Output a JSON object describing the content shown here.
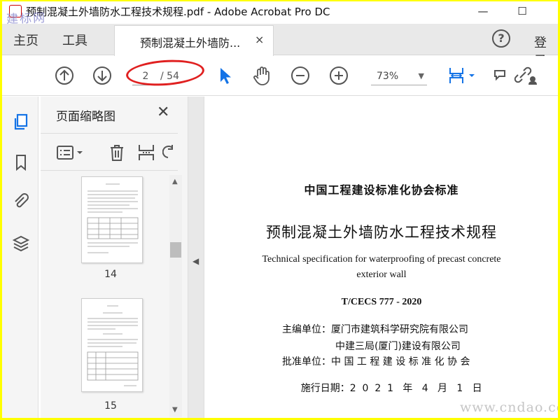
{
  "window": {
    "title": "预制混凝土外墙防水工程技术规程.pdf - Adobe Acrobat Pro DC",
    "minimize": "—",
    "maximize": "☐"
  },
  "watermark_top": "建标网",
  "tabs": {
    "home": "主页",
    "tools": "工具",
    "doc": "预制混凝土外墙防...",
    "close": "×",
    "help": "?",
    "login": "登录"
  },
  "toolbar": {
    "page_current": "2",
    "page_total": "/ 54",
    "zoom": "73%"
  },
  "thumbnails": {
    "title": "页面缩略图",
    "close": "✕",
    "pages": [
      {
        "number": "14"
      },
      {
        "number": "15"
      }
    ]
  },
  "document": {
    "org": "中国工程建设标准化协会标准",
    "title": "预制混凝土外墙防水工程技术规程",
    "english_line1": "Technical specification for waterproofing of precast concrete",
    "english_line2": "exterior wall",
    "code": "T/CECS 777 - 2020",
    "info": [
      {
        "label": "主编单位：",
        "value": "厦门市建筑科学研究院有限公司"
      },
      {
        "label": "",
        "value": "中建三局(厦门)建设有限公司"
      },
      {
        "label": "批准单位：",
        "value": "中 国 工 程 建 设 标 准 化 协 会"
      },
      {
        "label": "施行日期：",
        "value": "2  0  2  1   年   4   月   1   日"
      }
    ]
  },
  "watermark_bottom": "www.cndao.com",
  "colors": {
    "frame": "#ffff00",
    "accent_blue": "#1473e6",
    "highlight_red": "#e02020"
  }
}
